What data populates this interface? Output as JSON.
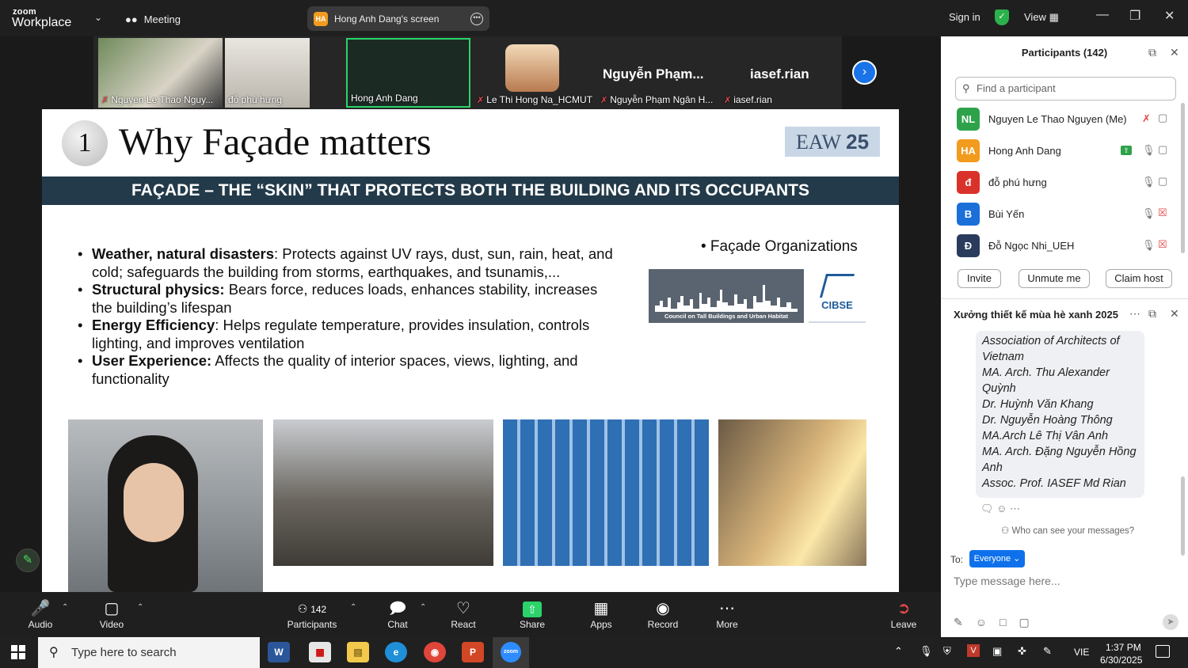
{
  "app": {
    "logo_small": "zoom",
    "logo_big": "Workplace",
    "meeting_label": "Meeting",
    "screen_share_initials": "HA",
    "screen_share_label": "Hong Anh Dang's screen",
    "sign_in": "Sign in",
    "view": "View"
  },
  "thumbnails": [
    {
      "name": "Nguyen Le Thao Nguy...",
      "muted": true
    },
    {
      "name": "đỗ phú hưng",
      "muted": false
    },
    {
      "name": "Hong Anh Dang",
      "muted": false,
      "active": true
    },
    {
      "name": "Le Thi Hong Na_HCMUT",
      "muted": true
    },
    {
      "name": "Nguyễn Phạm Ngân H...",
      "big": "Nguyễn Phạm...",
      "muted": true
    },
    {
      "name": "iasef.rian",
      "big": "iasef.rian",
      "muted": true
    }
  ],
  "slide": {
    "number": "1",
    "title": "Why Façade matters",
    "badge_a": "EAW ",
    "badge_b": "25",
    "banner": "FAÇADE – THE “SKIN” THAT PROTECTS BOTH THE BUILDING AND ITS OCCUPANTS",
    "bullets": [
      {
        "bold": "Weather, natural disasters",
        "text": ": Protects against UV rays, dust, sun, rain, heat, and cold; safeguards the building from storms, earthquakes, and tsunamis,..."
      },
      {
        "bold": "Structural physics:",
        "text": " Bears force, reduces loads, enhances stability, increases the building’s lifespan"
      },
      {
        "bold": "Energy Efficiency",
        "text": ": Helps regulate temperature, provides insulation, controls lighting, and improves ventilation"
      },
      {
        "bold": "User Experience:",
        "text": " Affects the quality of interior spaces, views, lighting, and functionality"
      }
    ],
    "org_title": "• Façade Organizations",
    "ctbuh_caption": "Council on Tall Buildings and Urban Habitat",
    "cibse_label": "CIBSE"
  },
  "toolbar": {
    "audio": "Audio",
    "video": "Video",
    "participants_count": "142",
    "participants": "Participants",
    "chat": "Chat",
    "react": "React",
    "share": "Share",
    "apps": "Apps",
    "record": "Record",
    "more": "More",
    "leave": "Leave"
  },
  "participants_panel": {
    "title": "Participants (142)",
    "search_placeholder": "Find a participant",
    "rows": [
      {
        "initials": "NL",
        "name": "Nguyen Le Thao Nguyen (Me)",
        "color": "#2ea24a",
        "mic_off": true,
        "cam_off": false
      },
      {
        "initials": "HA",
        "name": "Hong Anh Dang",
        "color": "#f29b1e",
        "mic_off": false,
        "cam_off": false
      },
      {
        "initials": "đ",
        "name": "đỗ phú hưng",
        "color": "#d9322b",
        "mic_off": false,
        "cam_off": false
      },
      {
        "initials": "B",
        "name": "Bùi Yến",
        "color": "#1a6fd8",
        "mic_off": false,
        "cam_off": true
      },
      {
        "initials": "Đ",
        "name": "Đỗ Ngọc Nhi_UEH",
        "color": "#2a3b5c",
        "mic_off": false,
        "cam_off": true
      }
    ],
    "invite": "Invite",
    "unmute": "Unmute me",
    "claim": "Claim host"
  },
  "chat_panel": {
    "title": "Xưởng thiết kế mùa hè xanh 2025",
    "message_lines": [
      "Association of Architects of",
      "Vietnam",
      "MA. Arch. Thu Alexander",
      "Quỳnh",
      "Dr. Huỳnh Văn Khang",
      "Dr. Nguyễn Hoàng Thông",
      "MA.Arch Lê Thị Vân Anh",
      "MA. Arch. Đặng Nguyễn Hồng",
      "Anh",
      "Assoc. Prof. IASEF Md Rian"
    ],
    "who_can_see": "Who can see your messages?",
    "to_label": "To:",
    "to_value": "Everyone",
    "input_placeholder": "Type message here..."
  },
  "taskbar": {
    "search_placeholder": "Type here to search",
    "lang": "VIE",
    "time": "1:37 PM",
    "date": "6/30/2025"
  }
}
